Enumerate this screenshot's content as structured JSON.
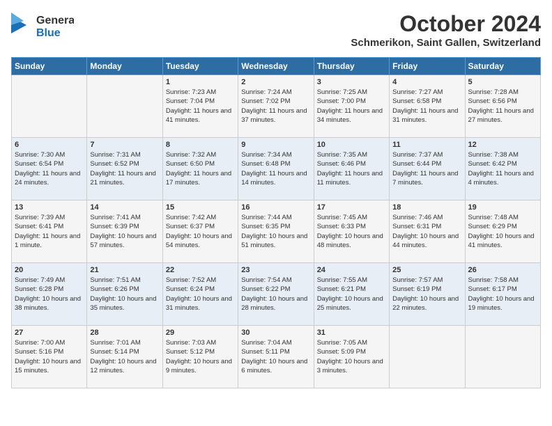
{
  "header": {
    "logo": {
      "general": "General",
      "blue": "Blue",
      "icon": "▶"
    },
    "title": "October 2024",
    "location": "Schmerikon, Saint Gallen, Switzerland"
  },
  "days_of_week": [
    "Sunday",
    "Monday",
    "Tuesday",
    "Wednesday",
    "Thursday",
    "Friday",
    "Saturday"
  ],
  "weeks": [
    [
      {
        "day": "",
        "content": ""
      },
      {
        "day": "",
        "content": ""
      },
      {
        "day": "1",
        "content": "Sunrise: 7:23 AM\nSunset: 7:04 PM\nDaylight: 11 hours and 41 minutes."
      },
      {
        "day": "2",
        "content": "Sunrise: 7:24 AM\nSunset: 7:02 PM\nDaylight: 11 hours and 37 minutes."
      },
      {
        "day": "3",
        "content": "Sunrise: 7:25 AM\nSunset: 7:00 PM\nDaylight: 11 hours and 34 minutes."
      },
      {
        "day": "4",
        "content": "Sunrise: 7:27 AM\nSunset: 6:58 PM\nDaylight: 11 hours and 31 minutes."
      },
      {
        "day": "5",
        "content": "Sunrise: 7:28 AM\nSunset: 6:56 PM\nDaylight: 11 hours and 27 minutes."
      }
    ],
    [
      {
        "day": "6",
        "content": "Sunrise: 7:30 AM\nSunset: 6:54 PM\nDaylight: 11 hours and 24 minutes."
      },
      {
        "day": "7",
        "content": "Sunrise: 7:31 AM\nSunset: 6:52 PM\nDaylight: 11 hours and 21 minutes."
      },
      {
        "day": "8",
        "content": "Sunrise: 7:32 AM\nSunset: 6:50 PM\nDaylight: 11 hours and 17 minutes."
      },
      {
        "day": "9",
        "content": "Sunrise: 7:34 AM\nSunset: 6:48 PM\nDaylight: 11 hours and 14 minutes."
      },
      {
        "day": "10",
        "content": "Sunrise: 7:35 AM\nSunset: 6:46 PM\nDaylight: 11 hours and 11 minutes."
      },
      {
        "day": "11",
        "content": "Sunrise: 7:37 AM\nSunset: 6:44 PM\nDaylight: 11 hours and 7 minutes."
      },
      {
        "day": "12",
        "content": "Sunrise: 7:38 AM\nSunset: 6:42 PM\nDaylight: 11 hours and 4 minutes."
      }
    ],
    [
      {
        "day": "13",
        "content": "Sunrise: 7:39 AM\nSunset: 6:41 PM\nDaylight: 11 hours and 1 minute."
      },
      {
        "day": "14",
        "content": "Sunrise: 7:41 AM\nSunset: 6:39 PM\nDaylight: 10 hours and 57 minutes."
      },
      {
        "day": "15",
        "content": "Sunrise: 7:42 AM\nSunset: 6:37 PM\nDaylight: 10 hours and 54 minutes."
      },
      {
        "day": "16",
        "content": "Sunrise: 7:44 AM\nSunset: 6:35 PM\nDaylight: 10 hours and 51 minutes."
      },
      {
        "day": "17",
        "content": "Sunrise: 7:45 AM\nSunset: 6:33 PM\nDaylight: 10 hours and 48 minutes."
      },
      {
        "day": "18",
        "content": "Sunrise: 7:46 AM\nSunset: 6:31 PM\nDaylight: 10 hours and 44 minutes."
      },
      {
        "day": "19",
        "content": "Sunrise: 7:48 AM\nSunset: 6:29 PM\nDaylight: 10 hours and 41 minutes."
      }
    ],
    [
      {
        "day": "20",
        "content": "Sunrise: 7:49 AM\nSunset: 6:28 PM\nDaylight: 10 hours and 38 minutes."
      },
      {
        "day": "21",
        "content": "Sunrise: 7:51 AM\nSunset: 6:26 PM\nDaylight: 10 hours and 35 minutes."
      },
      {
        "day": "22",
        "content": "Sunrise: 7:52 AM\nSunset: 6:24 PM\nDaylight: 10 hours and 31 minutes."
      },
      {
        "day": "23",
        "content": "Sunrise: 7:54 AM\nSunset: 6:22 PM\nDaylight: 10 hours and 28 minutes."
      },
      {
        "day": "24",
        "content": "Sunrise: 7:55 AM\nSunset: 6:21 PM\nDaylight: 10 hours and 25 minutes."
      },
      {
        "day": "25",
        "content": "Sunrise: 7:57 AM\nSunset: 6:19 PM\nDaylight: 10 hours and 22 minutes."
      },
      {
        "day": "26",
        "content": "Sunrise: 7:58 AM\nSunset: 6:17 PM\nDaylight: 10 hours and 19 minutes."
      }
    ],
    [
      {
        "day": "27",
        "content": "Sunrise: 7:00 AM\nSunset: 5:16 PM\nDaylight: 10 hours and 15 minutes."
      },
      {
        "day": "28",
        "content": "Sunrise: 7:01 AM\nSunset: 5:14 PM\nDaylight: 10 hours and 12 minutes."
      },
      {
        "day": "29",
        "content": "Sunrise: 7:03 AM\nSunset: 5:12 PM\nDaylight: 10 hours and 9 minutes."
      },
      {
        "day": "30",
        "content": "Sunrise: 7:04 AM\nSunset: 5:11 PM\nDaylight: 10 hours and 6 minutes."
      },
      {
        "day": "31",
        "content": "Sunrise: 7:05 AM\nSunset: 5:09 PM\nDaylight: 10 hours and 3 minutes."
      },
      {
        "day": "",
        "content": ""
      },
      {
        "day": "",
        "content": ""
      }
    ]
  ]
}
